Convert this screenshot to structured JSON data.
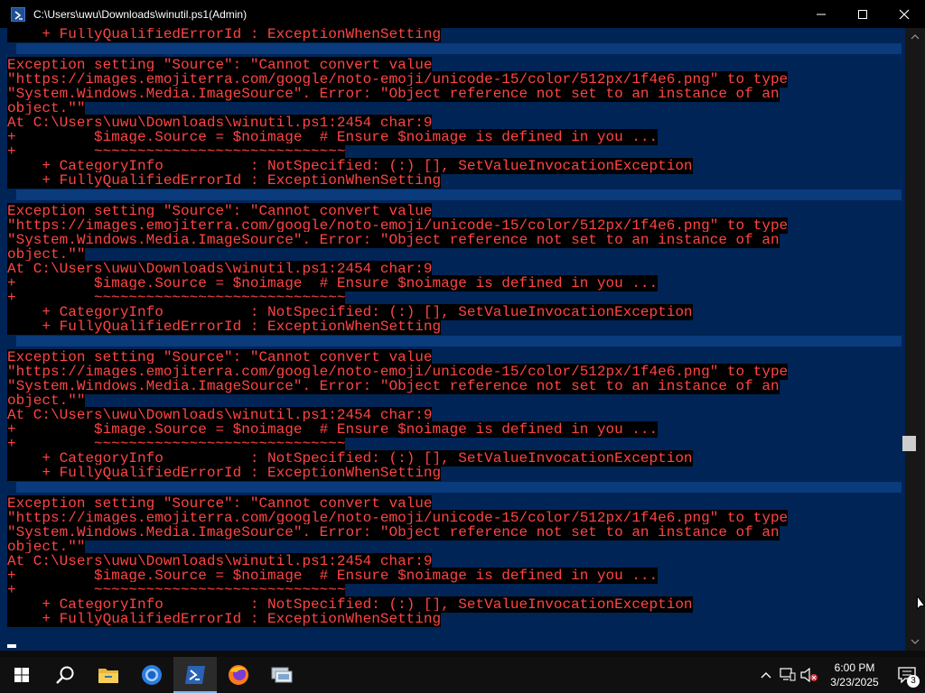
{
  "window": {
    "title": "C:\\Users\\uwu\\Downloads\\winutil.ps1(Admin)",
    "controls": [
      "minimize",
      "maximize",
      "close"
    ]
  },
  "console": {
    "lines": [
      "    + FullyQualifiedErrorId : ExceptionWhenSetting",
      "",
      "Exception setting \"Source\": \"Cannot convert value",
      "\"https://images.emojiterra.com/google/noto-emoji/unicode-15/color/512px/1f4e6.png\" to type",
      "\"System.Windows.Media.ImageSource\". Error: \"Object reference not set to an instance of an",
      "object.\"\"",
      "At C:\\Users\\uwu\\Downloads\\winutil.ps1:2454 char:9",
      "+         $image.Source = $noimage  # Ensure $noimage is defined in you ...",
      "+         ~~~~~~~~~~~~~~~~~~~~~~~~~~~~~",
      "    + CategoryInfo          : NotSpecified: (:) [], SetValueInvocationException",
      "    + FullyQualifiedErrorId : ExceptionWhenSetting",
      "",
      "Exception setting \"Source\": \"Cannot convert value",
      "\"https://images.emojiterra.com/google/noto-emoji/unicode-15/color/512px/1f4e6.png\" to type",
      "\"System.Windows.Media.ImageSource\". Error: \"Object reference not set to an instance of an",
      "object.\"\"",
      "At C:\\Users\\uwu\\Downloads\\winutil.ps1:2454 char:9",
      "+         $image.Source = $noimage  # Ensure $noimage is defined in you ...",
      "+         ~~~~~~~~~~~~~~~~~~~~~~~~~~~~~",
      "    + CategoryInfo          : NotSpecified: (:) [], SetValueInvocationException",
      "    + FullyQualifiedErrorId : ExceptionWhenSetting",
      "",
      "Exception setting \"Source\": \"Cannot convert value",
      "\"https://images.emojiterra.com/google/noto-emoji/unicode-15/color/512px/1f4e6.png\" to type",
      "\"System.Windows.Media.ImageSource\". Error: \"Object reference not set to an instance of an",
      "object.\"\"",
      "At C:\\Users\\uwu\\Downloads\\winutil.ps1:2454 char:9",
      "+         $image.Source = $noimage  # Ensure $noimage is defined in you ...",
      "+         ~~~~~~~~~~~~~~~~~~~~~~~~~~~~~",
      "    + CategoryInfo          : NotSpecified: (:) [], SetValueInvocationException",
      "    + FullyQualifiedErrorId : ExceptionWhenSetting",
      "",
      "Exception setting \"Source\": \"Cannot convert value",
      "\"https://images.emojiterra.com/google/noto-emoji/unicode-15/color/512px/1f4e6.png\" to type",
      "\"System.Windows.Media.ImageSource\". Error: \"Object reference not set to an instance of an",
      "object.\"\"",
      "At C:\\Users\\uwu\\Downloads\\winutil.ps1:2454 char:9",
      "+         $image.Source = $noimage  # Ensure $noimage is defined in you ...",
      "+         ~~~~~~~~~~~~~~~~~~~~~~~~~~~~~",
      "    + CategoryInfo          : NotSpecified: (:) [], SetValueInvocationException",
      "    + FullyQualifiedErrorId : ExceptionWhenSetting"
    ],
    "colors": {
      "background": "#012456",
      "error_text": "#ff4444",
      "error_bg": "#000000",
      "selection": "#0a3b7c"
    }
  },
  "taskbar": {
    "apps": [
      "start-icon",
      "search-icon",
      "file-explorer-icon",
      "chrome-icon",
      "powershell-icon",
      "firefox-icon",
      "network-app-icon"
    ],
    "active_app": "powershell-icon",
    "clock": {
      "time": "6:00 PM",
      "date": "3/23/2025"
    },
    "notification_count": "3"
  }
}
